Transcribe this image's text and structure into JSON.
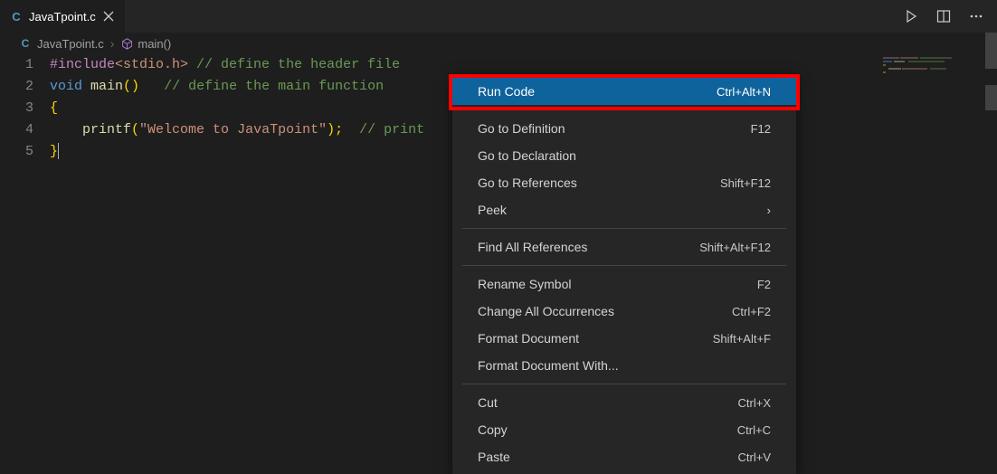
{
  "tab": {
    "filename": "JavaTpoint.c",
    "icon": "c-file-icon"
  },
  "breadcrumb": {
    "file": "JavaTpoint.c",
    "symbol": "main()"
  },
  "code": {
    "line_numbers": [
      "1",
      "2",
      "3",
      "4",
      "5"
    ],
    "l1_include": "#include",
    "l1_header": "<stdio.h>",
    "l1_comment": "// define the header file",
    "l2_kw1": "void",
    "l2_fn": "main",
    "l2_paren": "()",
    "l2_comment": "// define the main function",
    "l3_brace": "{",
    "l4_indent": "    ",
    "l4_fn": "printf",
    "l4_open": "(",
    "l4_str": "\"Welcome to JavaTpoint\"",
    "l4_close": ");",
    "l4_comment": "// print",
    "l5_brace": "}"
  },
  "context_menu": [
    {
      "label": "Run Code",
      "shortcut": "Ctrl+Alt+N",
      "highlighted": true
    },
    {
      "sep": true
    },
    {
      "label": "Go to Definition",
      "shortcut": "F12"
    },
    {
      "label": "Go to Declaration",
      "shortcut": ""
    },
    {
      "label": "Go to References",
      "shortcut": "Shift+F12"
    },
    {
      "label": "Peek",
      "submenu": true
    },
    {
      "sep": true
    },
    {
      "label": "Find All References",
      "shortcut": "Shift+Alt+F12"
    },
    {
      "sep": true
    },
    {
      "label": "Rename Symbol",
      "shortcut": "F2"
    },
    {
      "label": "Change All Occurrences",
      "shortcut": "Ctrl+F2"
    },
    {
      "label": "Format Document",
      "shortcut": "Shift+Alt+F"
    },
    {
      "label": "Format Document With...",
      "shortcut": ""
    },
    {
      "sep": true
    },
    {
      "label": "Cut",
      "shortcut": "Ctrl+X"
    },
    {
      "label": "Copy",
      "shortcut": "Ctrl+C"
    },
    {
      "label": "Paste",
      "shortcut": "Ctrl+V"
    }
  ]
}
